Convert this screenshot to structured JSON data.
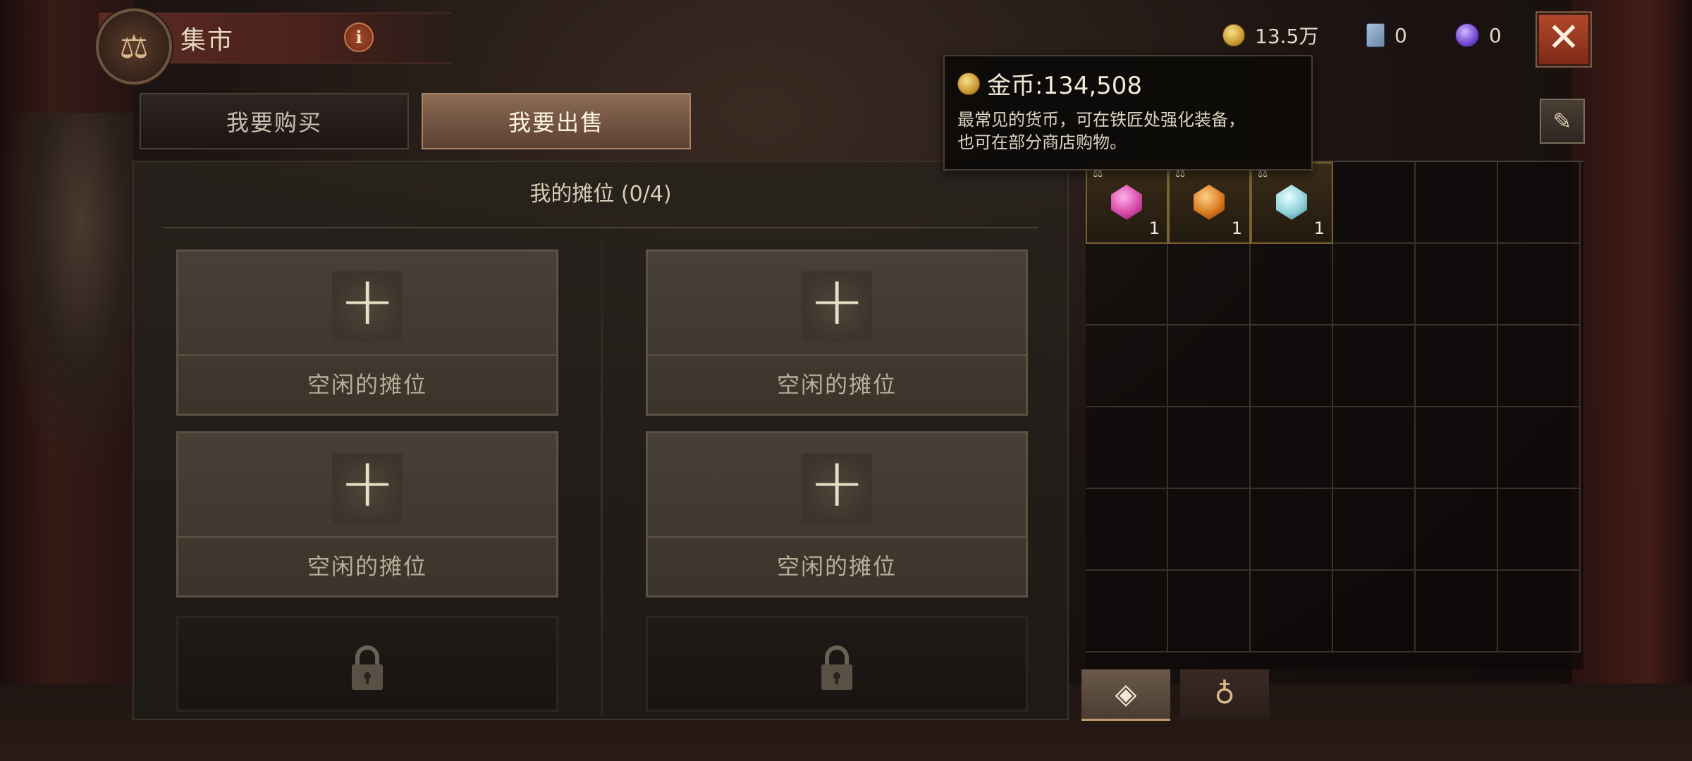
{
  "header": {
    "title": "集市",
    "info_label": "i",
    "close_label": "✕"
  },
  "currencies": [
    {
      "name": "gold",
      "value": "13.5万",
      "icon": "gold-coin-icon"
    },
    {
      "name": "card",
      "value": "0",
      "icon": "card-icon"
    },
    {
      "name": "orb",
      "value": "0",
      "icon": "purple-orb-icon"
    }
  ],
  "tabs": [
    {
      "label": "我要购买",
      "active": false
    },
    {
      "label": "我要出售",
      "active": true
    }
  ],
  "stalls": {
    "header": "我的摊位 (0/4)",
    "empty_slots": [
      "空闲的摊位",
      "空闲的摊位",
      "空闲的摊位",
      "空闲的摊位"
    ],
    "plus_symbol": "+"
  },
  "tooltip": {
    "title": "金币:134,508",
    "description_line1": "最常见的货币，可在铁匠处强化装备，",
    "description_line2": "也可在部分商店购物。"
  },
  "inventory": {
    "edit_icon": "edit-list-icon",
    "items": [
      {
        "name": "pink-gem",
        "count": "1",
        "color": "#d64aa8"
      },
      {
        "name": "amber-gem",
        "count": "1",
        "color": "#d9791e"
      },
      {
        "name": "aqua-gem",
        "count": "1",
        "color": "#8fd0d8"
      }
    ],
    "tabs": [
      {
        "icon": "gems-icon",
        "active": true
      },
      {
        "icon": "bag-icon",
        "active": false
      }
    ]
  },
  "colors": {
    "accent": "#b3482a",
    "active_tab": "#8b6b54",
    "gold": "#c99a32"
  }
}
